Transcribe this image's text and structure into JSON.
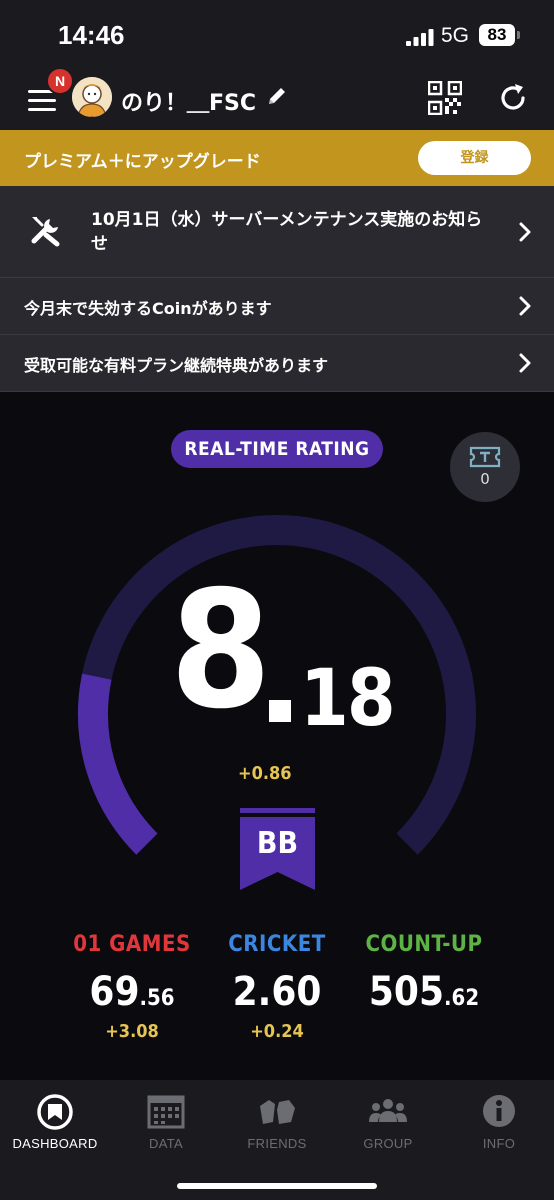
{
  "status": {
    "time": "14:46",
    "network": "5G",
    "battery": "83"
  },
  "header": {
    "username": "のり！＿FSC",
    "badge": "N"
  },
  "premium": {
    "text": "プレミアム＋にアップグレード",
    "button": "登録"
  },
  "notices": [
    {
      "text": "10月1日（水）サーバーメンテナンス実施のお知らせ"
    },
    {
      "text": "今月末で失効するCoinがあります"
    },
    {
      "text": "受取可能な有料プラン継続特典があります"
    }
  ],
  "rating": {
    "title": "REAL-TIME RATING",
    "tickets": "0",
    "integer": "8",
    "decimal": "18",
    "diff": "+0.86",
    "class": "BB",
    "gauge_fill_fraction": 0.21
  },
  "stats": [
    {
      "name": "01 GAMES",
      "whole": "69",
      "fraction": "56",
      "diff": "+3.08",
      "color": "#e0383a"
    },
    {
      "name": "CRICKET",
      "whole": "2",
      "fraction": "60",
      "diff": "+0.24",
      "color": "#3a86e0"
    },
    {
      "name": "COUNT-UP",
      "whole": "505",
      "fraction": "62",
      "diff": "",
      "color": "#5db343"
    }
  ],
  "tabs": [
    {
      "label": "DASHBOARD",
      "icon": "dashboard-icon"
    },
    {
      "label": "DATA",
      "icon": "calendar-icon"
    },
    {
      "label": "FRIENDS",
      "icon": "friends-icon"
    },
    {
      "label": "GROUP",
      "icon": "group-icon"
    },
    {
      "label": "INFO",
      "icon": "info-icon"
    }
  ],
  "colors": {
    "accent": "#4f2ea7",
    "gold": "#c2951e",
    "diff": "#e7c552"
  }
}
